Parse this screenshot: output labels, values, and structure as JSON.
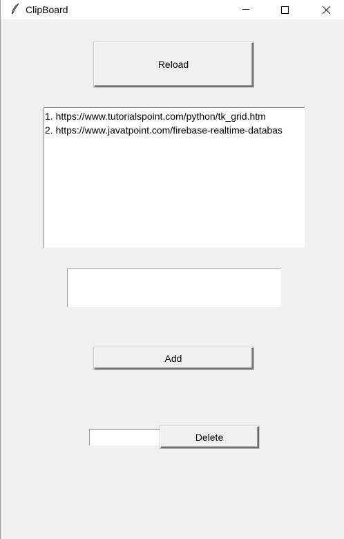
{
  "window": {
    "title": "ClipBoard",
    "icon": "feather-icon",
    "controls": {
      "minimize": "minimize-icon",
      "maximize": "maximize-icon",
      "close": "close-icon"
    }
  },
  "buttons": {
    "reload_label": "Reload",
    "add_label": "Add",
    "delete_label": "Delete"
  },
  "clipboard_list": {
    "items": [
      {
        "label": "1. https://www.tutorialspoint.com/python/tk_grid.htm"
      },
      {
        "label": "2. https://www.javatpoint.com/firebase-realtime-databas"
      }
    ]
  },
  "add_entry": {
    "value": "",
    "placeholder": ""
  },
  "delete_entry": {
    "value": "",
    "placeholder": ""
  }
}
